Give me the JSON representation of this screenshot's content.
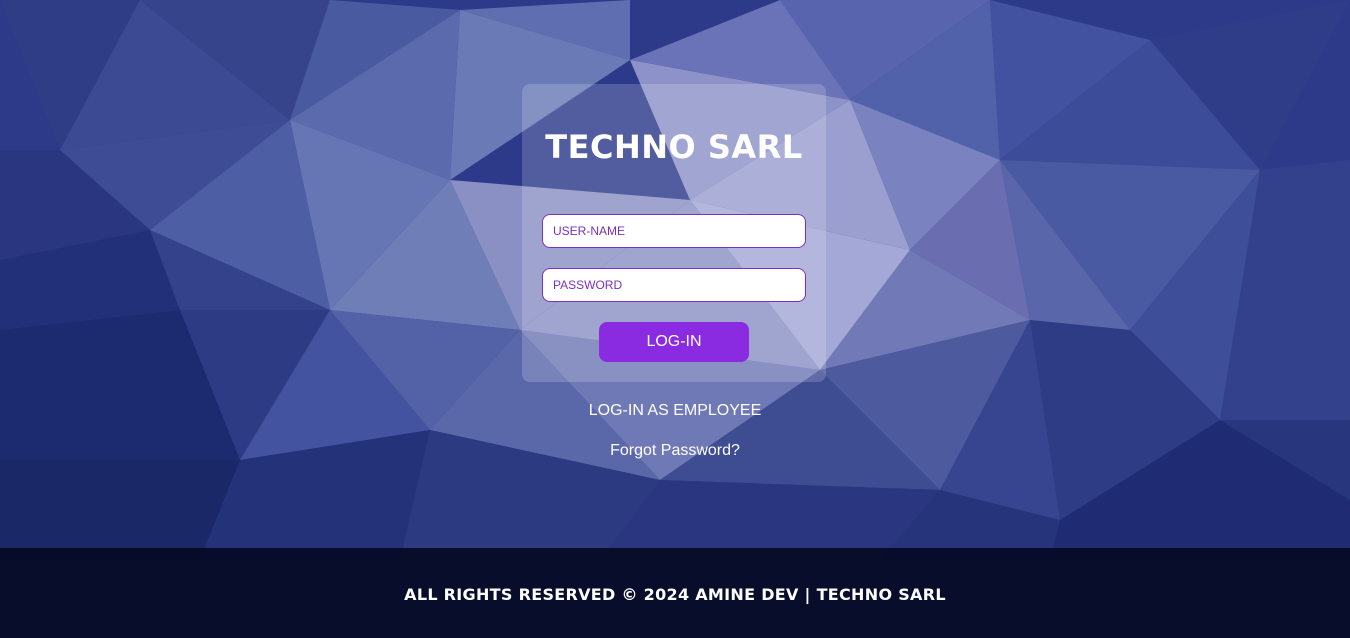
{
  "login": {
    "title": "TECHNO SARL",
    "username_placeholder": "USER-NAME",
    "password_placeholder": "PASSWORD",
    "login_button": "LOG-IN"
  },
  "links": {
    "employee": "LOG-IN AS EMPLOYEE",
    "forgot": "Forgot Password?"
  },
  "footer": {
    "text": "ALL RIGHTS RESERVED © 2024 AMINE DEV | TECHNO SARL"
  },
  "colors": {
    "accent": "#8a2be2",
    "field_border": "#7b2fbf",
    "background": "#2d3a8a",
    "footer_bg": "#050a23"
  }
}
